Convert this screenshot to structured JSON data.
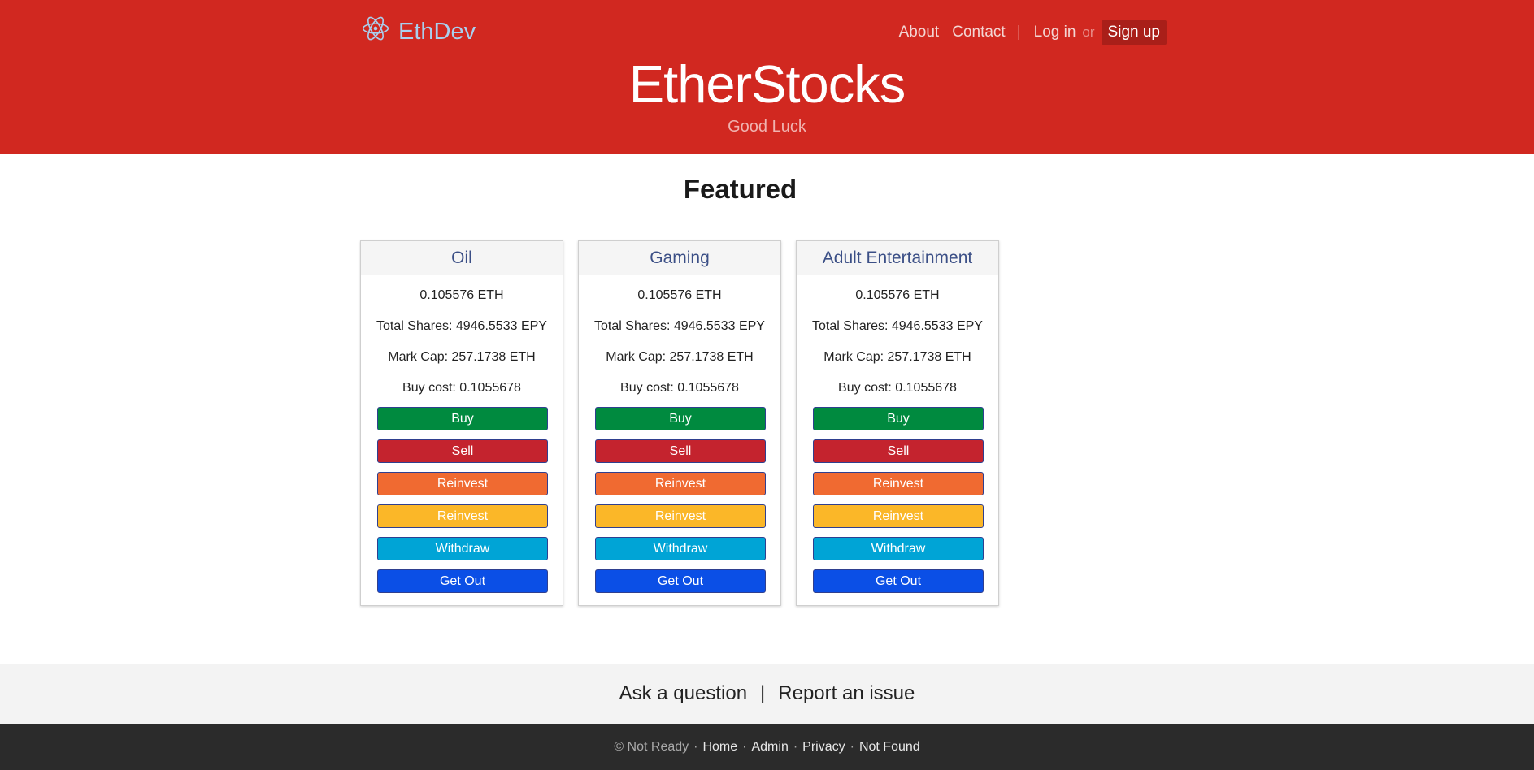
{
  "brand": {
    "name": "EthDev",
    "icon": "atom-icon",
    "icon_color": "#a9cfee"
  },
  "nav": {
    "about": "About",
    "contact": "Contact",
    "separator": "|",
    "login": "Log in",
    "or": "or",
    "signup": "Sign up"
  },
  "hero": {
    "title": "EtherStocks",
    "subtitle": "Good Luck",
    "background": "#d12820"
  },
  "featured": {
    "heading": "Featured",
    "cards": [
      {
        "title": "Oil",
        "price": "0.105576 ETH",
        "total_shares": "Total Shares: 4946.5533 EPY",
        "market_cap": "Mark Cap: 257.1738 ETH",
        "buy_cost": "Buy cost: 0.1055678"
      },
      {
        "title": "Gaming",
        "price": "0.105576 ETH",
        "total_shares": "Total Shares: 4946.5533 EPY",
        "market_cap": "Mark Cap: 257.1738 ETH",
        "buy_cost": "Buy cost: 0.1055678"
      },
      {
        "title": "Adult Entertainment",
        "price": "0.105576 ETH",
        "total_shares": "Total Shares: 4946.5533 EPY",
        "market_cap": "Mark Cap: 257.1738 ETH",
        "buy_cost": "Buy cost: 0.1055678"
      }
    ],
    "buttons": [
      {
        "label": "Buy",
        "color": "#008a3f"
      },
      {
        "label": "Sell",
        "color": "#c4232e"
      },
      {
        "label": "Reinvest",
        "color": "#f06a31"
      },
      {
        "label": "Reinvest",
        "color": "#fbb728"
      },
      {
        "label": "Withdraw",
        "color": "#00a4d6"
      },
      {
        "label": "Get Out",
        "color": "#0b4fe6"
      }
    ]
  },
  "footer": {
    "ask": "Ask a question",
    "pipe": "|",
    "report": "Report an issue",
    "copyright": "© Not Ready",
    "dot": "·",
    "links": [
      "Home",
      "Admin",
      "Privacy",
      "Not Found"
    ]
  }
}
